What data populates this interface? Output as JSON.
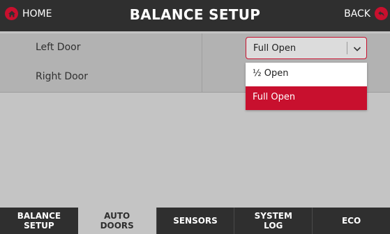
{
  "header": {
    "title": "BALANCE SETUP",
    "home_label": "HOME",
    "back_label": "BACK",
    "accent_color": "#c8102e"
  },
  "rows": [
    {
      "label": "Left Door",
      "selected": "Full Open"
    },
    {
      "label": "Right Door"
    }
  ],
  "dropdown": {
    "options": [
      {
        "label": "½ Open",
        "highlighted": false
      },
      {
        "label": "Full Open",
        "highlighted": true
      }
    ]
  },
  "tabs": [
    {
      "label": "BALANCE\nSETUP",
      "active": false
    },
    {
      "label": "AUTO\nDOORS",
      "active": true
    },
    {
      "label": "SENSORS",
      "active": false
    },
    {
      "label": "SYSTEM\nLOG",
      "active": false
    },
    {
      "label": "ECO",
      "active": false
    }
  ]
}
